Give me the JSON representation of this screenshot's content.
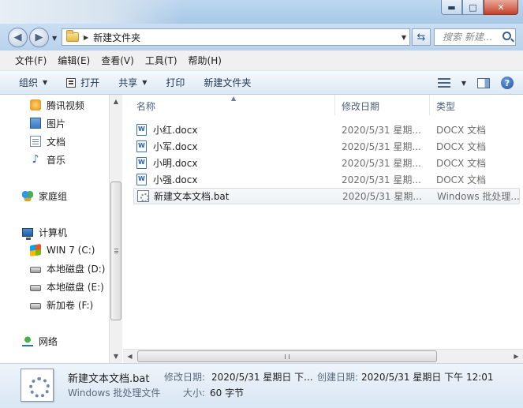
{
  "window": {
    "controls": {
      "minimize": "▬",
      "maximize": "□",
      "close": "✕"
    }
  },
  "navigation": {
    "address_path": "新建文件夹",
    "search_placeholder": "搜索 新建..."
  },
  "menu": [
    "文件(F)",
    "编辑(E)",
    "查看(V)",
    "工具(T)",
    "帮助(H)"
  ],
  "toolbar": {
    "organize": "组织",
    "open": "打开",
    "share": "共享",
    "print": "打印",
    "new_folder": "新建文件夹"
  },
  "sidebar": {
    "favorites": [
      {
        "label": "腾讯视频",
        "icon": "video-icon"
      },
      {
        "label": "图片",
        "icon": "picture-icon"
      },
      {
        "label": "文档",
        "icon": "document-icon"
      },
      {
        "label": "音乐",
        "icon": "music-icon"
      }
    ],
    "homegroup": "家庭组",
    "computer": "计算机",
    "drives": [
      {
        "label": "WIN 7 (C:)",
        "icon": "windows-drive-icon"
      },
      {
        "label": "本地磁盘 (D:)",
        "icon": "drive-icon"
      },
      {
        "label": "本地磁盘 (E:)",
        "icon": "drive-icon"
      },
      {
        "label": "新加卷 (F:)",
        "icon": "drive-icon"
      }
    ],
    "network": "网络"
  },
  "columns": {
    "name": "名称",
    "date": "修改日期",
    "type": "类型"
  },
  "files": [
    {
      "name": "小红.docx",
      "date": "2020/5/31 星期...",
      "type": "DOCX 文档",
      "icon": "word-doc-icon"
    },
    {
      "name": "小军.docx",
      "date": "2020/5/31 星期...",
      "type": "DOCX 文档",
      "icon": "word-doc-icon"
    },
    {
      "name": "小明.docx",
      "date": "2020/5/31 星期...",
      "type": "DOCX 文档",
      "icon": "word-doc-icon"
    },
    {
      "name": "小强.docx",
      "date": "2020/5/31 星期...",
      "type": "DOCX 文档",
      "icon": "word-doc-icon"
    },
    {
      "name": "新建文本文档.bat",
      "date": "2020/5/31 星期...",
      "type": "Windows 批处理...",
      "icon": "batch-file-icon",
      "selected": true
    }
  ],
  "details": {
    "name": "新建文本文档.bat",
    "type": "Windows 批处理文件",
    "modified_label": "修改日期:",
    "modified_value": "2020/5/31 星期日 下...",
    "created_label": "创建日期:",
    "created_value": "2020/5/31 星期日 下午 12:01",
    "size_label": "大小:",
    "size_value": "60 字节"
  }
}
